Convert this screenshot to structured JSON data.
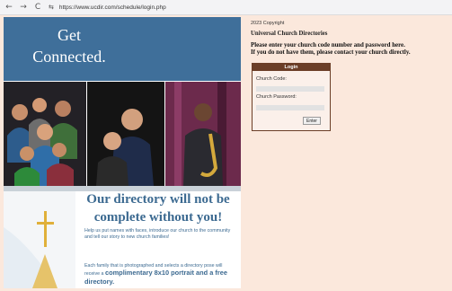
{
  "browser": {
    "back_glyph": "←",
    "forward_glyph": "→",
    "reload_glyph": "C",
    "site_info_glyph": "⇆",
    "url": "https://www.ucdir.com/schedule/login.php"
  },
  "banner": {
    "headline_line1": "Get",
    "headline_line2": "Connected.",
    "tagline_line1": "Our directory will not be",
    "tagline_line2": "complete without you!",
    "blurb_1": "Help us put names with faces, introduce our church to the community and tell our story to new church families!",
    "blurb_2_start": "Each family that is photographed and selects a directory pose will receive a",
    "blurb_2_highlight": "complimentary 8x10 portrait and a free directory."
  },
  "sidebar": {
    "copyright": "2023 Copyright",
    "site_title": "Universal Church Directories",
    "instruction_line1": "Please enter your church code number and password here.",
    "instruction_line2": "If you do not have them, please contact your church directly."
  },
  "login": {
    "header": "Login",
    "code_label": "Church Code:",
    "code_value": "",
    "password_label": "Church Password:",
    "password_value": "",
    "enter_label": "Enter"
  },
  "colors": {
    "page_background": "#fbe8dc",
    "banner_blue": "#3f6f9a",
    "login_brown": "#6b3e27"
  }
}
